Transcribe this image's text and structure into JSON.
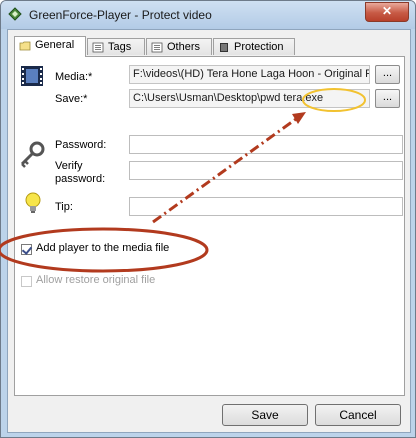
{
  "window": {
    "title": "GreenForce-Player - Protect video",
    "close_label": "✕",
    "icon": "greenforce-app-icon"
  },
  "tabs": [
    {
      "label": "General",
      "icon": "folder-icon",
      "active": true
    },
    {
      "label": "Tags",
      "icon": "list-icon",
      "active": false
    },
    {
      "label": "Others",
      "icon": "list-icon",
      "active": false
    },
    {
      "label": "Protection",
      "icon": "lock-icon",
      "active": false
    }
  ],
  "general": {
    "media_label": "Media:*",
    "media_value": "F:\\videos\\(HD) Tera Hone Laga Hoon - Original F",
    "save_label": "Save:*",
    "save_value": "C:\\Users\\Usman\\Desktop\\pwd tera.exe",
    "browse_label": "...",
    "password_label": "Password:",
    "password_value": "",
    "verify_label_line1": "Verify",
    "verify_label_line2": "password:",
    "verify_value": "",
    "tip_label": "Tip:",
    "tip_value": "",
    "add_player_label": "Add player to the media file",
    "add_player_checked": true,
    "allow_restore_label": "Allow restore original file",
    "allow_restore_checked": false
  },
  "footer": {
    "save_button": "Save",
    "cancel_button": "Cancel"
  },
  "annotation_colors": {
    "ellipse_checkbox": "#b23a1e",
    "arrow": "#b23a1e",
    "ellipse_exe": "#f2c230"
  }
}
